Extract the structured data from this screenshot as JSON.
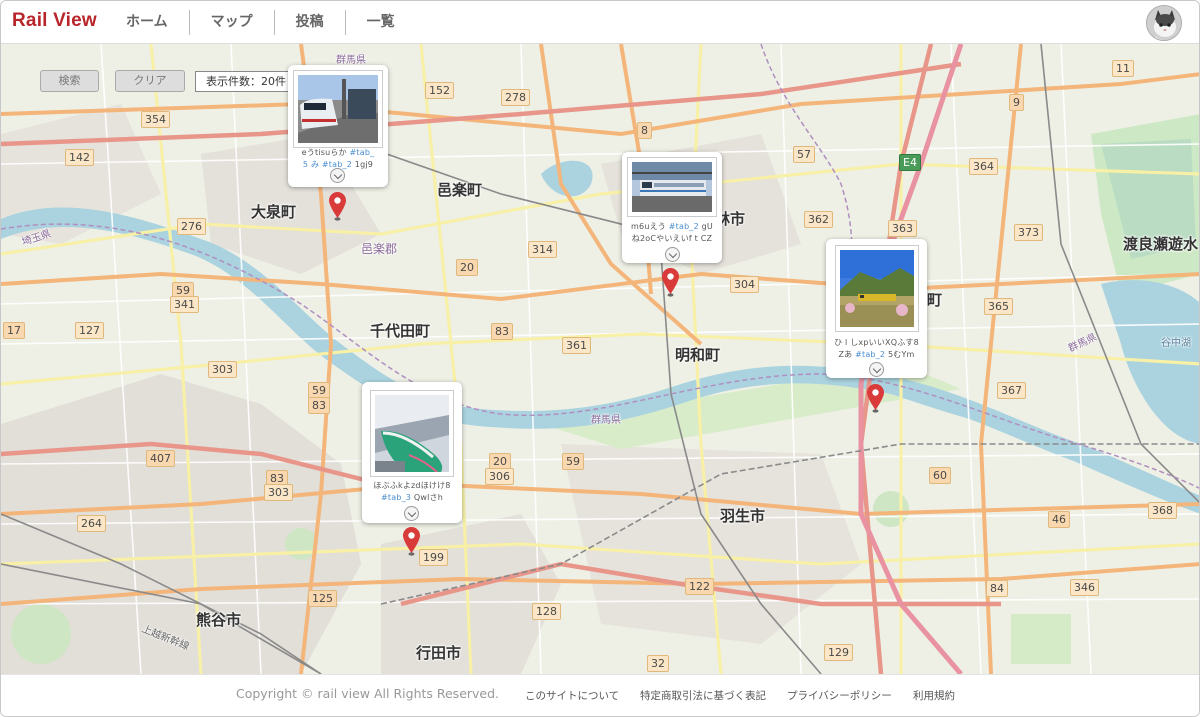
{
  "app": {
    "logo": "Rail View"
  },
  "nav": {
    "items": [
      {
        "label": "ホーム"
      },
      {
        "label": "マップ"
      },
      {
        "label": "投稿"
      },
      {
        "label": "一覧"
      }
    ]
  },
  "controls": {
    "search_label": "検索",
    "clear_label": "クリア",
    "display_count": "表示件数：20件"
  },
  "map": {
    "places": {
      "ooizumi": "大泉町",
      "ouramachi": "邑楽町",
      "ouragun": "邑楽郡",
      "chiyoda": "千代田町",
      "meiwa": "明和町",
      "hanyu": "羽生市",
      "kumagaya": "熊谷市",
      "gyoda": "行田市",
      "tatebayashi": "林市",
      "itakura_part": "町",
      "watarase": "渡良瀬遊水",
      "gunma1": "群馬県",
      "gunma2": "群馬県",
      "gunma3": "群馬県",
      "saitama": "埼玉県",
      "tonecho": "上越新幹線",
      "tanaka": "谷中湖"
    },
    "roads": {
      "r354": "354",
      "r142": "142",
      "r152": "152",
      "r278": "278",
      "r8": "8",
      "r57": "57",
      "r9": "9",
      "r11": "11",
      "r364": "364",
      "r276": "276",
      "r314": "314",
      "r20a": "20",
      "r362": "362",
      "r363": "363",
      "r373": "373",
      "r59a": "59",
      "r341": "341",
      "r17": "17",
      "r127": "127",
      "r83a": "83",
      "r361": "361",
      "r304": "304",
      "r365": "365",
      "r303a": "303",
      "r59b": "59",
      "r83b": "83",
      "r367": "367",
      "r407": "407",
      "r20b": "20",
      "r306": "306",
      "r59c": "59",
      "r60": "60",
      "r83c": "83",
      "r303b": "303",
      "r264": "264",
      "r46": "46",
      "r368": "368",
      "r199": "199",
      "r125": "125",
      "r122": "122",
      "r128": "128",
      "r84": "84",
      "r346": "346",
      "r129": "129",
      "r32": "32",
      "e4": "E4"
    }
  },
  "posts": [
    {
      "caption_a": "eうtisuらか ",
      "tag_a": "#tab_",
      "caption_b": "5 み ",
      "tag_b": "#tab_2",
      "caption_c": " 1gj9"
    },
    {
      "caption_a": "m6uえう ",
      "tag_a": "#tab_2",
      "caption_b": " gU",
      "caption_c": "ね2oCやいえいf t CZ"
    },
    {
      "caption_a": "ひ l しxpいいXQふす8",
      "caption_b": "Zあ ",
      "tag_b": "#tab_2",
      "caption_c": " 5むYm"
    },
    {
      "caption_a": "ほぶふkよzdほけけ8",
      "tag_b": "#tab_3",
      "caption_c": " Qwlさh"
    }
  ],
  "footer": {
    "copyright": "Copyright © rail view All Rights Reserved.",
    "links": [
      {
        "label": "このサイトについて"
      },
      {
        "label": "特定商取引法に基づく表記"
      },
      {
        "label": "プライバシーポリシー"
      },
      {
        "label": "利用規約"
      }
    ]
  },
  "colors": {
    "brand": "#b8262c",
    "pin": "#d93a3a",
    "tag": "#4a8fcf",
    "river": "#aad3df",
    "highway": "#e892a2"
  }
}
